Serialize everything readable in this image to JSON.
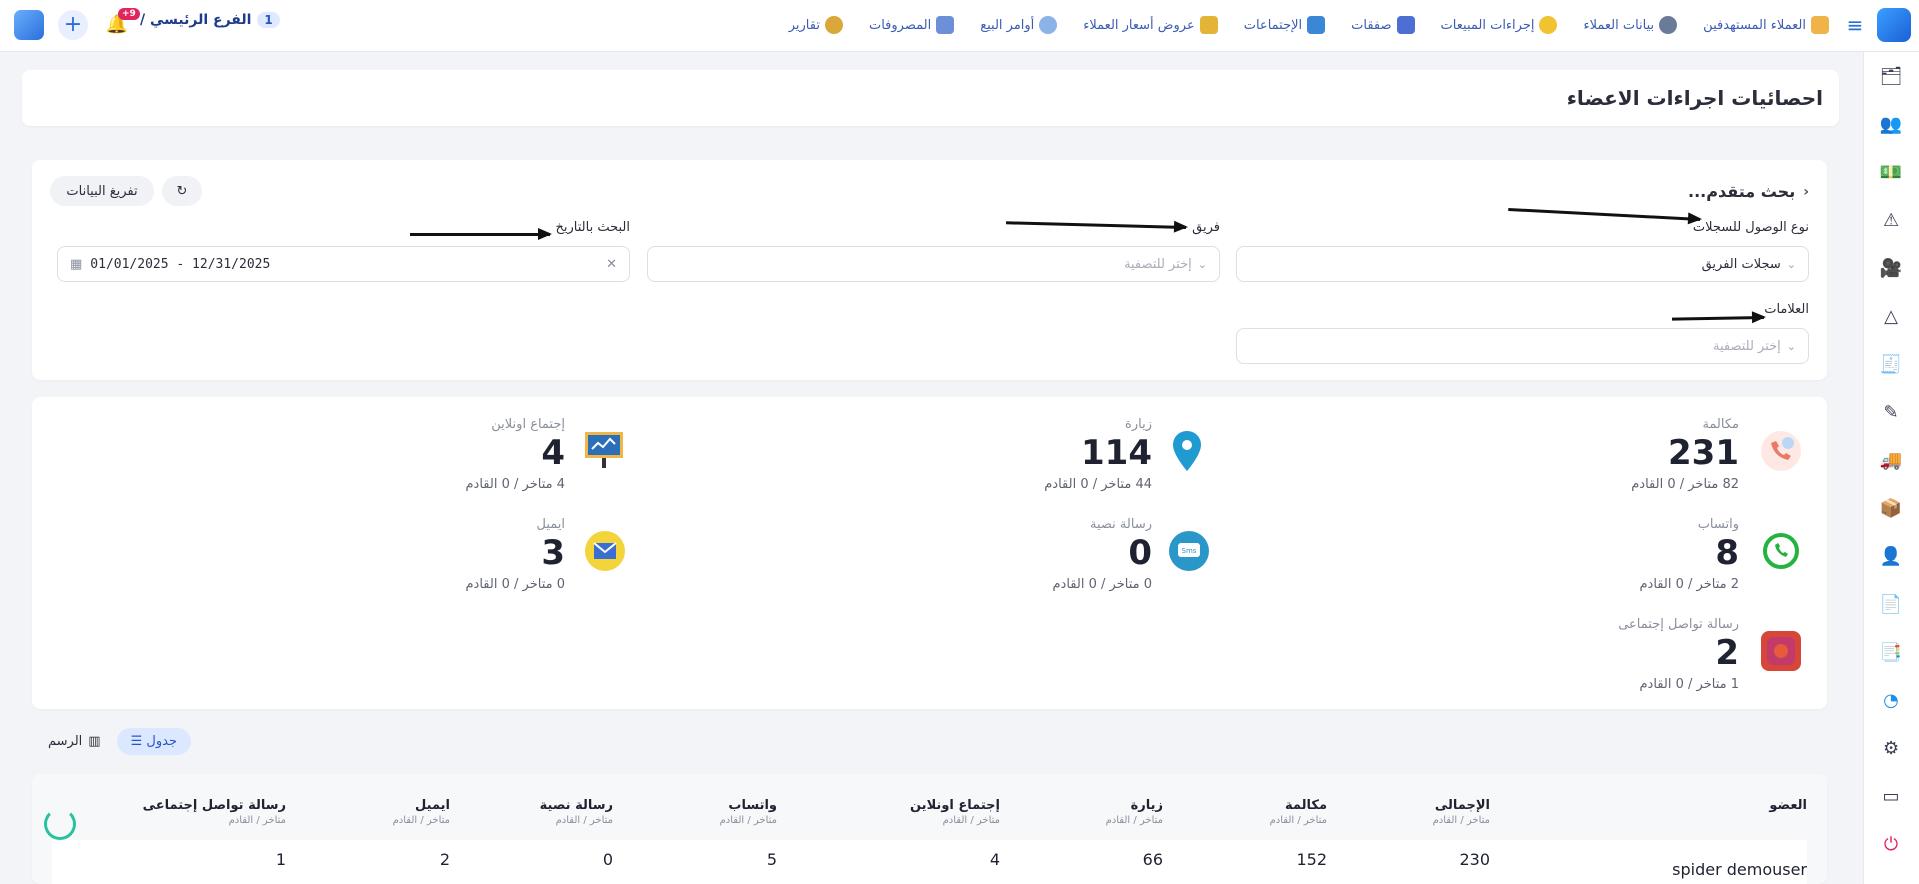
{
  "topbar": {
    "nav": [
      {
        "label": "العملاء المستهدفين",
        "icon": "target-customers-icon"
      },
      {
        "label": "بيانات العملاء",
        "icon": "customer-data-icon"
      },
      {
        "label": "إجراءات المبيعات",
        "icon": "sales-actions-icon"
      },
      {
        "label": "صفقات",
        "icon": "deals-icon"
      },
      {
        "label": "الإجتماعات",
        "icon": "meetings-icon"
      },
      {
        "label": "عروض أسعار العملاء",
        "icon": "quotes-icon"
      },
      {
        "label": "أوامر البيع",
        "icon": "sales-orders-icon"
      },
      {
        "label": "المصروفات",
        "icon": "expenses-icon"
      },
      {
        "label": "تقارير",
        "icon": "reports-icon"
      }
    ],
    "branch_number": "1",
    "branch_name": "الفرع الرئيسي /",
    "notification_count": "9+"
  },
  "page": {
    "title": "احصائيات اجراءات الاعضاء"
  },
  "filters": {
    "advanced_search": "بحث متقدم...",
    "clear_button": "تفريغ البيانات",
    "access_type_label": "نوع الوصول للسجلات",
    "access_type_value": "سجلات الفريق",
    "team_label": "فريق",
    "team_placeholder": "إختر للتصفية",
    "date_label": "البحث بالتاريخ",
    "date_value": "01/01/2025 - 12/31/2025",
    "tags_label": "العلامات",
    "tags_placeholder": "إختر للتصفية"
  },
  "stats": [
    {
      "label": "مكالمة",
      "value": "231",
      "sub": "82 متاخر / 0 القادم",
      "icon": "phone-icon"
    },
    {
      "label": "زيارة",
      "value": "114",
      "sub": "44 متاخر / 0 القادم",
      "icon": "location-pin-icon"
    },
    {
      "label": "إجتماع اونلاين",
      "value": "4",
      "sub": "4 متاخر / 0 القادم",
      "icon": "presentation-board-icon"
    },
    {
      "label": "واتساب",
      "value": "8",
      "sub": "2 متاخر / 0 القادم",
      "icon": "whatsapp-icon"
    },
    {
      "label": "رسالة نصية",
      "value": "0",
      "sub": "0 متاخر / 0 القادم",
      "icon": "sms-icon"
    },
    {
      "label": "ايميل",
      "value": "3",
      "sub": "0 متاخر / 0 القادم",
      "icon": "email-icon"
    },
    {
      "label": "رسالة تواصل إجتماعى",
      "value": "2",
      "sub": "1 متاخر / 0 القادم",
      "icon": "social-message-icon"
    }
  ],
  "view_toggle": {
    "table_label": "جدول",
    "chart_label": "الرسم"
  },
  "table": {
    "sub_header": "متاخر / القادم",
    "columns": [
      "العضو",
      "الإجمالى",
      "مكالمة",
      "زيارة",
      "إجتماع اونلاين",
      "واتساب",
      "رسالة نصية",
      "ايميل",
      "رسالة تواصل إجتماعى"
    ],
    "rows": [
      {
        "member": "spider demouser",
        "values": [
          "230",
          "152",
          "66",
          "4",
          "5",
          "0",
          "2",
          "1"
        ]
      }
    ]
  },
  "colors": {
    "primary": "#2a6fd8",
    "nav_text": "#3b5cb3",
    "accent_green": "#29c19f",
    "badge_red": "#e0245e"
  }
}
